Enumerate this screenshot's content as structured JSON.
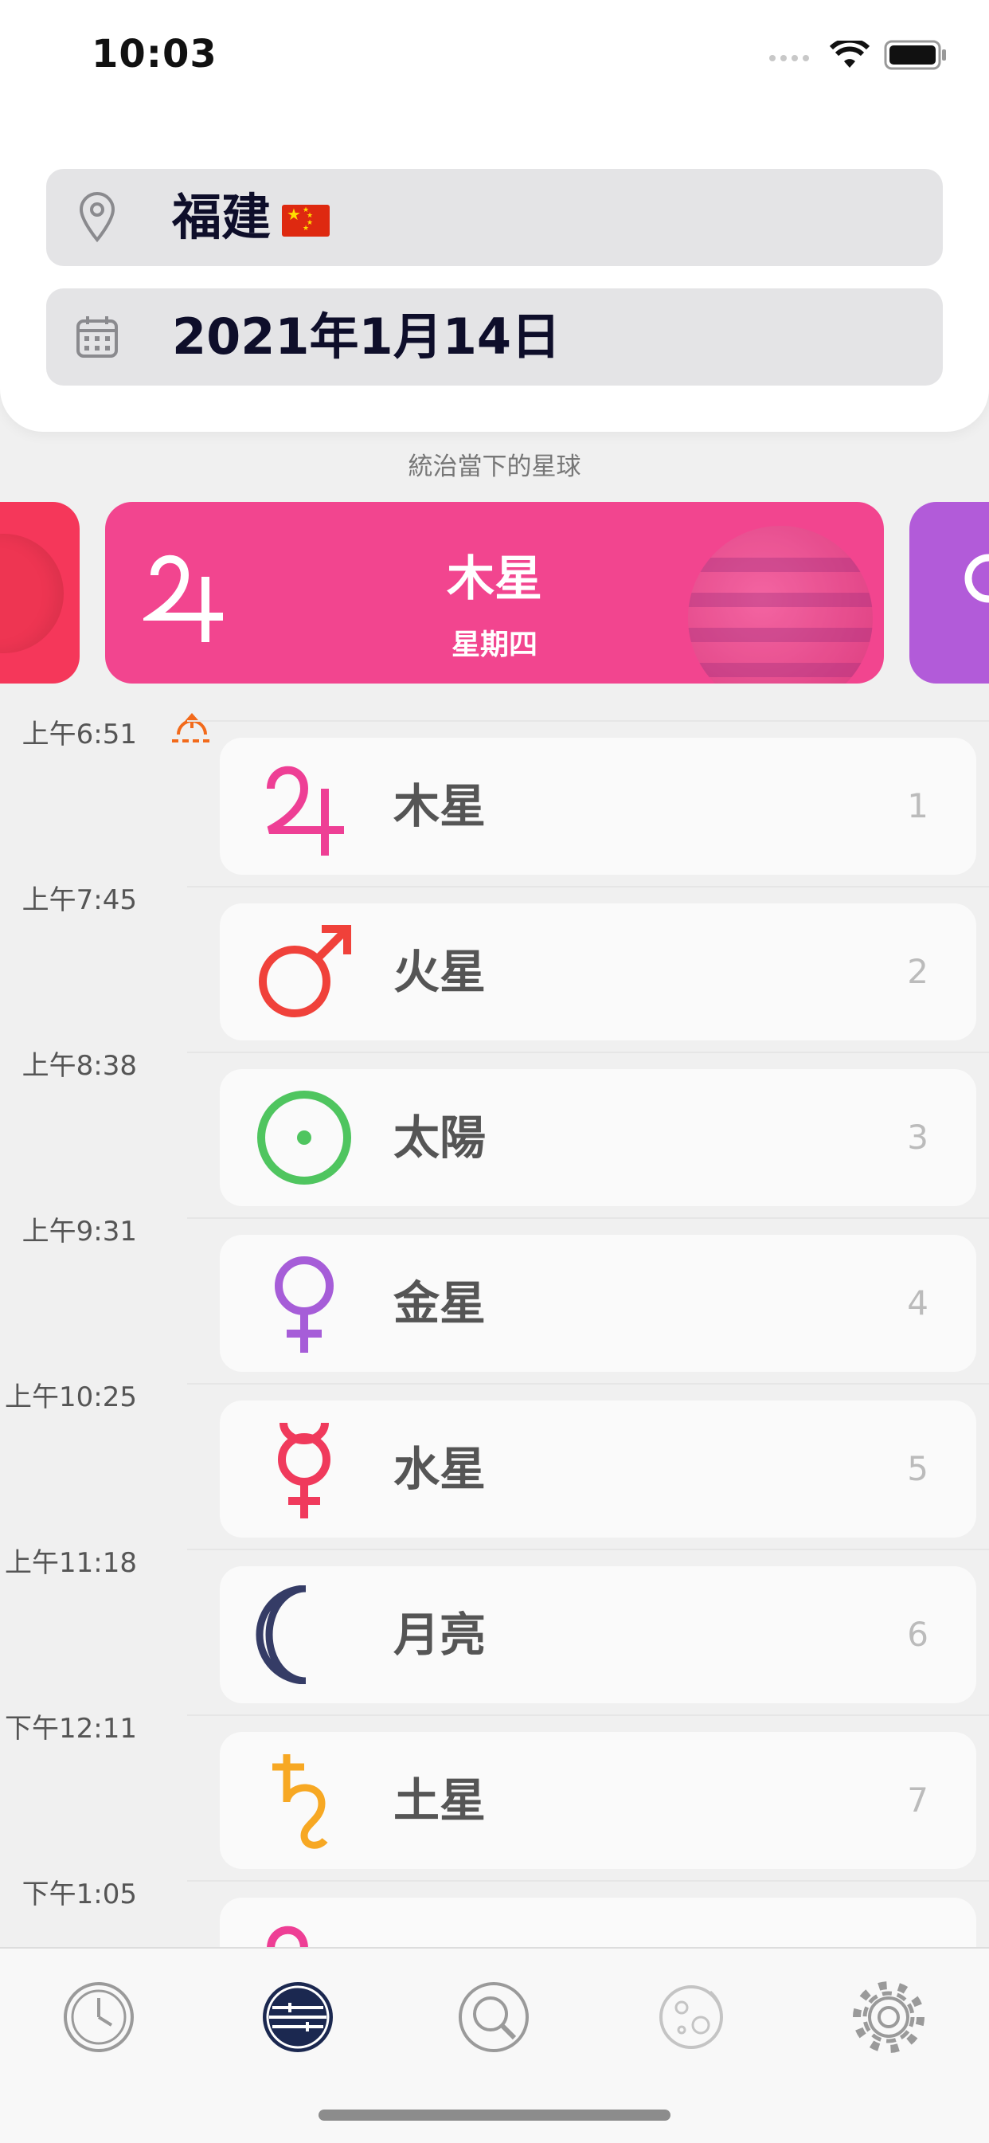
{
  "status": {
    "time": "10:03"
  },
  "location": {
    "value": "福建"
  },
  "date": {
    "value": "2021年1月14日"
  },
  "ruling": {
    "caption": "統治當下的星球",
    "planet": "木星",
    "weekday": "星期四"
  },
  "hours": [
    {
      "time": "上午6:51",
      "planet": "木星",
      "index": "1",
      "color": "#ee3f95",
      "icon": "jupiter-icon"
    },
    {
      "time": "上午7:45",
      "planet": "火星",
      "index": "2",
      "color": "#f0413a",
      "icon": "mars-icon"
    },
    {
      "time": "上午8:38",
      "planet": "太陽",
      "index": "3",
      "color": "#4fc55f",
      "icon": "sun-icon"
    },
    {
      "time": "上午9:31",
      "planet": "金星",
      "index": "4",
      "color": "#a65dd8",
      "icon": "venus-icon"
    },
    {
      "time": "上午10:25",
      "planet": "水星",
      "index": "5",
      "color": "#f03a5c",
      "icon": "mercury-icon"
    },
    {
      "time": "上午11:18",
      "planet": "月亮",
      "index": "6",
      "color": "#353c66",
      "icon": "moon-icon"
    },
    {
      "time": "下午12:11",
      "planet": "土星",
      "index": "7",
      "color": "#f7a823",
      "icon": "saturn-icon"
    },
    {
      "time": "下午1:05",
      "planet": "",
      "index": "",
      "color": "#ee3f95",
      "icon": "jupiter-icon"
    }
  ],
  "tabs": [
    {
      "name": "clock-icon",
      "active": false
    },
    {
      "name": "planetary-hours-icon",
      "active": true
    },
    {
      "name": "search-icon",
      "active": false
    },
    {
      "name": "moon-phase-icon",
      "active": false
    },
    {
      "name": "settings-gear-icon",
      "active": false
    }
  ],
  "colors": {
    "jupiter_card": "#f2458f",
    "mars_card": "#f5375a",
    "venus_card": "#b25bd9",
    "sunrise_icon": "#f26a1b"
  }
}
